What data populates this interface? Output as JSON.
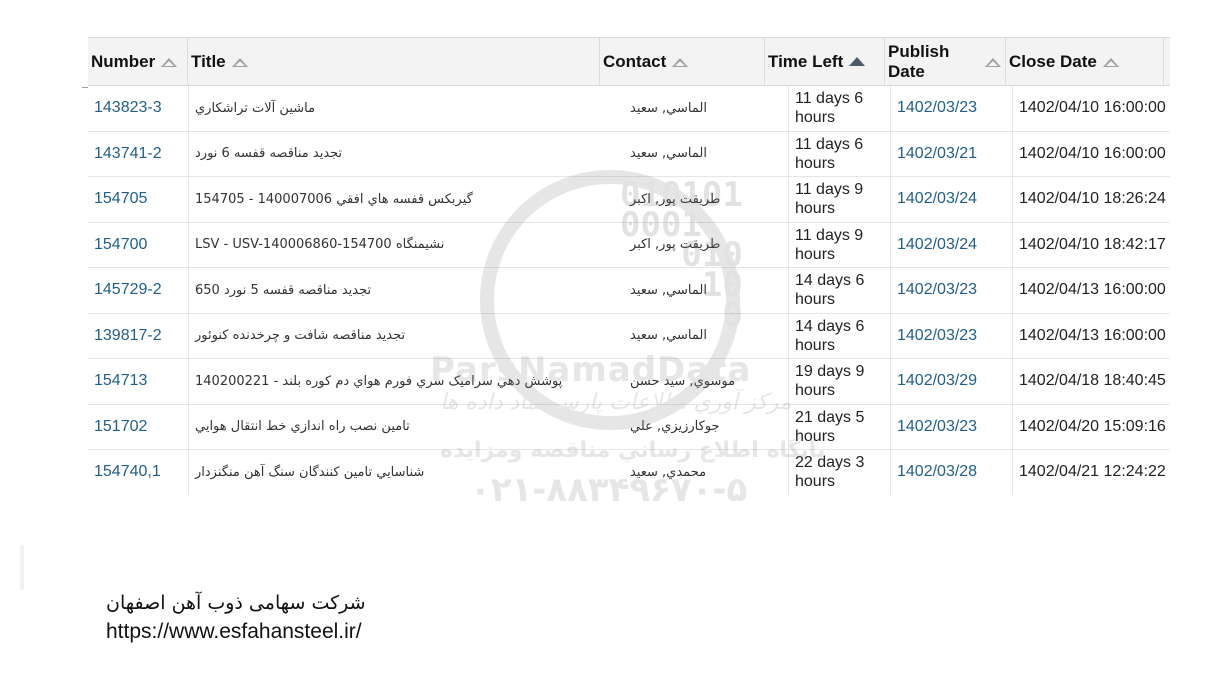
{
  "grid": {
    "headers": {
      "number": "Number",
      "title": "Title",
      "contact": "Contact",
      "time_left": "Time Left",
      "publish_date_1": "Publish",
      "publish_date_2": "Date",
      "close_date": "Close Date"
    },
    "sorted_column": "time_left",
    "rows": [
      {
        "number": "143823-3",
        "title": "ماشين آلات تراشکاري",
        "contact": "الماسي, سعيد",
        "time1": "11 days 6",
        "time2": "hours",
        "publish": "1402/03/23",
        "close": "1402/04/10 16:00:00"
      },
      {
        "number": "143741-2",
        "title": "تجديد مناقصه قفسه 6 نورد",
        "contact": "الماسي, سعيد",
        "time1": "11 days 6",
        "time2": "hours",
        "publish": "1402/03/21",
        "close": "1402/04/10 16:00:00"
      },
      {
        "number": "154705",
        "title": "گيربکس قفسه هاي افقي 140007006 - 154705",
        "contact": "طريقت پور, اکبر",
        "time1": "11 days 9",
        "time2": "hours",
        "publish": "1402/03/24",
        "close": "1402/04/10 18:26:24"
      },
      {
        "number": "154700",
        "title": "LSV - USV-140006860-154700 نشيمنگاه",
        "contact": "طريقت پور, اکبر",
        "time1": "11 days 9",
        "time2": "hours",
        "publish": "1402/03/24",
        "close": "1402/04/10 18:42:17"
      },
      {
        "number": "145729-2",
        "title": "تجديد مناقصه قفسه 5 نورد 650",
        "contact": "الماسي, سعيد",
        "time1": "14 days 6",
        "time2": "hours",
        "publish": "1402/03/23",
        "close": "1402/04/13 16:00:00"
      },
      {
        "number": "139817-2",
        "title": "تجديد مناقصه شافت و چرخدنده کنوئور",
        "contact": "الماسي, سعيد",
        "time1": "14 days 6",
        "time2": "hours",
        "publish": "1402/03/23",
        "close": "1402/04/13 16:00:00"
      },
      {
        "number": "154713",
        "title": "پوشش دهي سراميک سري فورم هواي دم کوره بلند - 140200221",
        "contact": "موسوي, سيد حسن",
        "time1": "19 days 9",
        "time2": "hours",
        "publish": "1402/03/29",
        "close": "1402/04/18 18:40:45"
      },
      {
        "number": "151702",
        "title": "تامين نصب راه اندازي خط انتقال هوايي",
        "contact": "جوکارزيزي, علي",
        "time1": "21 days 5",
        "time2": "hours",
        "publish": "1402/03/23",
        "close": "1402/04/20 15:09:16"
      },
      {
        "number": "154740,1",
        "title": "شناسايي تامين کنندگان سنگ آهن منگنزدار",
        "contact": "محمدي, سعيد",
        "time1": "22 days 3",
        "time2": "hours",
        "publish": "1402/03/28",
        "close": "1402/04/21 12:24:22"
      }
    ]
  },
  "watermark": {
    "digits": "010101\n0001\n   010\n    10\n     0",
    "brand": "ParsNamadData",
    "line1": "مرکز آوري اطلاعات پارس نماد داده ها",
    "line2": "پايگاه اطلاع رساني مناقصه ومزايده",
    "line3": "۰۲۱-۸۸۳۴۹۶۷۰-۵"
  },
  "footer": {
    "company": "شرکت سهامی ذوب آهن اصفهان",
    "url": "https://www.esfahansteel.ir/"
  }
}
